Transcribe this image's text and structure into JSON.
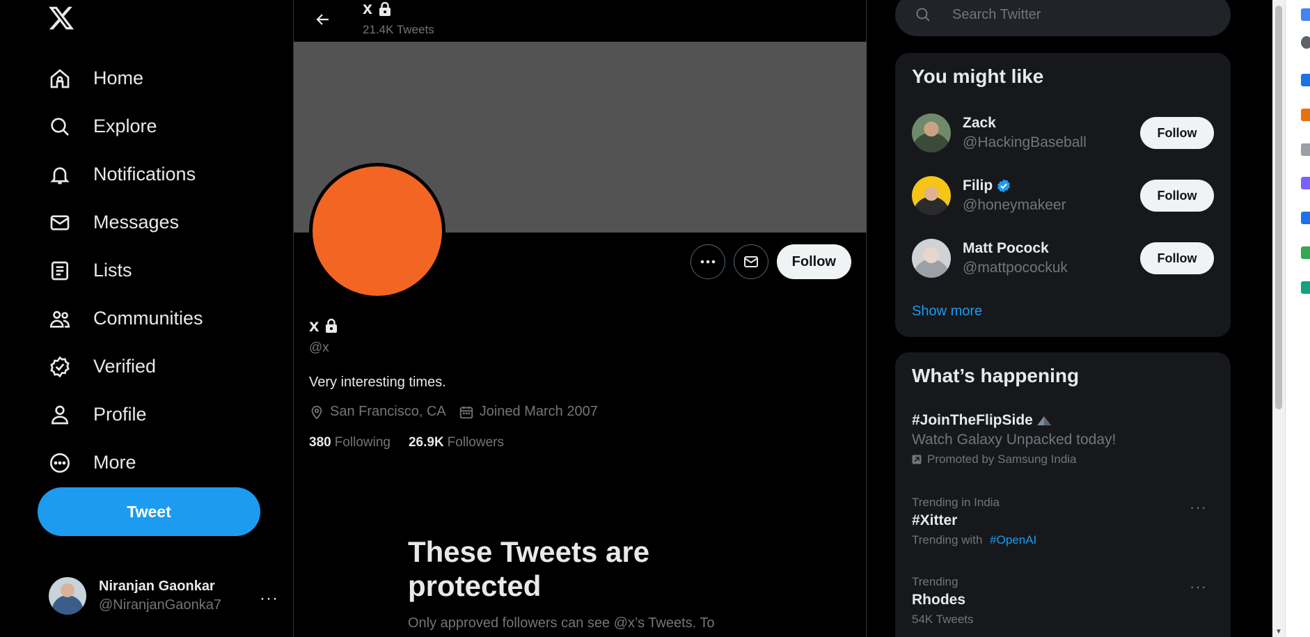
{
  "nav": {
    "items": [
      {
        "label": "Home",
        "icon": "home-icon"
      },
      {
        "label": "Explore",
        "icon": "search-icon"
      },
      {
        "label": "Notifications",
        "icon": "bell-icon"
      },
      {
        "label": "Messages",
        "icon": "envelope-icon"
      },
      {
        "label": "Lists",
        "icon": "list-icon"
      },
      {
        "label": "Communities",
        "icon": "people-icon"
      },
      {
        "label": "Verified",
        "icon": "verified-badge-icon"
      },
      {
        "label": "Profile",
        "icon": "person-icon"
      },
      {
        "label": "More",
        "icon": "more-circle-icon"
      }
    ],
    "tweet_label": "Tweet"
  },
  "account": {
    "name": "Niranjan Gaonkar",
    "handle": "@NiranjanGaonka7",
    "more": "···"
  },
  "header": {
    "title": "x",
    "tweet_count": "21.4K Tweets"
  },
  "profile": {
    "name": "x",
    "handle": "@x",
    "bio": "Very interesting times.",
    "location": "San Francisco, CA",
    "joined": "Joined March 2007",
    "following_count": "380",
    "following_label": "Following",
    "followers_count": "26.9K",
    "followers_label": "Followers",
    "follow_label": "Follow",
    "avatar_color": "#f26522",
    "banner_color": "#535353"
  },
  "protected": {
    "title": "These Tweets are protected",
    "body": "Only approved followers can see @x’s Tweets. To"
  },
  "search": {
    "placeholder": "Search Twitter"
  },
  "suggestions": {
    "title": "You might like",
    "items": [
      {
        "name": "Zack",
        "handle": "@HackingBaseball",
        "verified": false,
        "follow": "Follow"
      },
      {
        "name": "Filip",
        "handle": "@honeymakeer",
        "verified": true,
        "follow": "Follow"
      },
      {
        "name": "Matt Pocock",
        "handle": "@mattpocockuk",
        "verified": false,
        "follow": "Follow"
      }
    ],
    "show_more": "Show more"
  },
  "happening": {
    "title": "What’s happening",
    "promoted": {
      "tag": "#JoinTheFlipSide",
      "desc": "Watch Galaxy Unpacked today!",
      "by": "Promoted by Samsung India"
    },
    "trends": [
      {
        "meta": "Trending in India",
        "title": "#Xitter",
        "sub_prefix": "Trending with",
        "sub_link": "#OpenAI"
      },
      {
        "meta": "Trending",
        "title": "Rhodes",
        "count": "54K Tweets"
      }
    ]
  },
  "colors": {
    "accent": "#1d9bf0",
    "background": "#000000",
    "card": "#16181c"
  }
}
